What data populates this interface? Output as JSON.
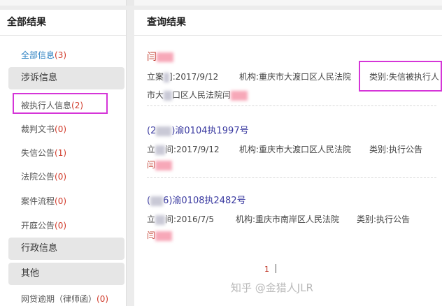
{
  "sidebar": {
    "title": "全部结果",
    "all_label": "全部信息",
    "all_count": "(3)",
    "group_litigation": "涉诉信息",
    "items": [
      {
        "label": "被执行人信息",
        "count": "(2)"
      },
      {
        "label": "裁判文书",
        "count": "(0)"
      },
      {
        "label": "失信公告",
        "count": "(1)"
      },
      {
        "label": "法院公告",
        "count": "(0)"
      },
      {
        "label": "案件流程",
        "count": "(0)"
      },
      {
        "label": "开庭公告",
        "count": "(0)"
      }
    ],
    "group_admin": "行政信息",
    "group_other": "其他",
    "loan_label": "网贷逾期（律师函）",
    "loan_count": "(0)"
  },
  "results": {
    "title": "查询结果",
    "items": [
      {
        "title": "闫",
        "date_label": "立案",
        "date": "]:2017/9/12",
        "agency": "机构:重庆市大渡口区人民法院",
        "category": "类别:失信被执行人",
        "extra_a": "市大",
        "extra_b": "口区人民法院闫"
      },
      {
        "title_prefix": "(2",
        "title": ")渝0104执1997号",
        "date_label": "立",
        "date": "间:2017/9/12",
        "agency": "机构:重庆市大渡口区人民法院",
        "category": "类别:执行公告",
        "extra": "闫"
      },
      {
        "title_prefix": "(",
        "title": "6)渝0108执2482号",
        "date_label": "立",
        "date": "间:2016/7/5",
        "agency": "机构:重庆市南岸区人民法院",
        "category": "类别:执行公告",
        "extra": "闫"
      }
    ]
  },
  "pager": {
    "current": "1"
  },
  "watermark": "知乎 @金猎人JLR",
  "colors": {
    "highlight": "#d535d8",
    "count": "#d13b2b",
    "link": "#3a3aa0",
    "active": "#2a7fc1"
  }
}
